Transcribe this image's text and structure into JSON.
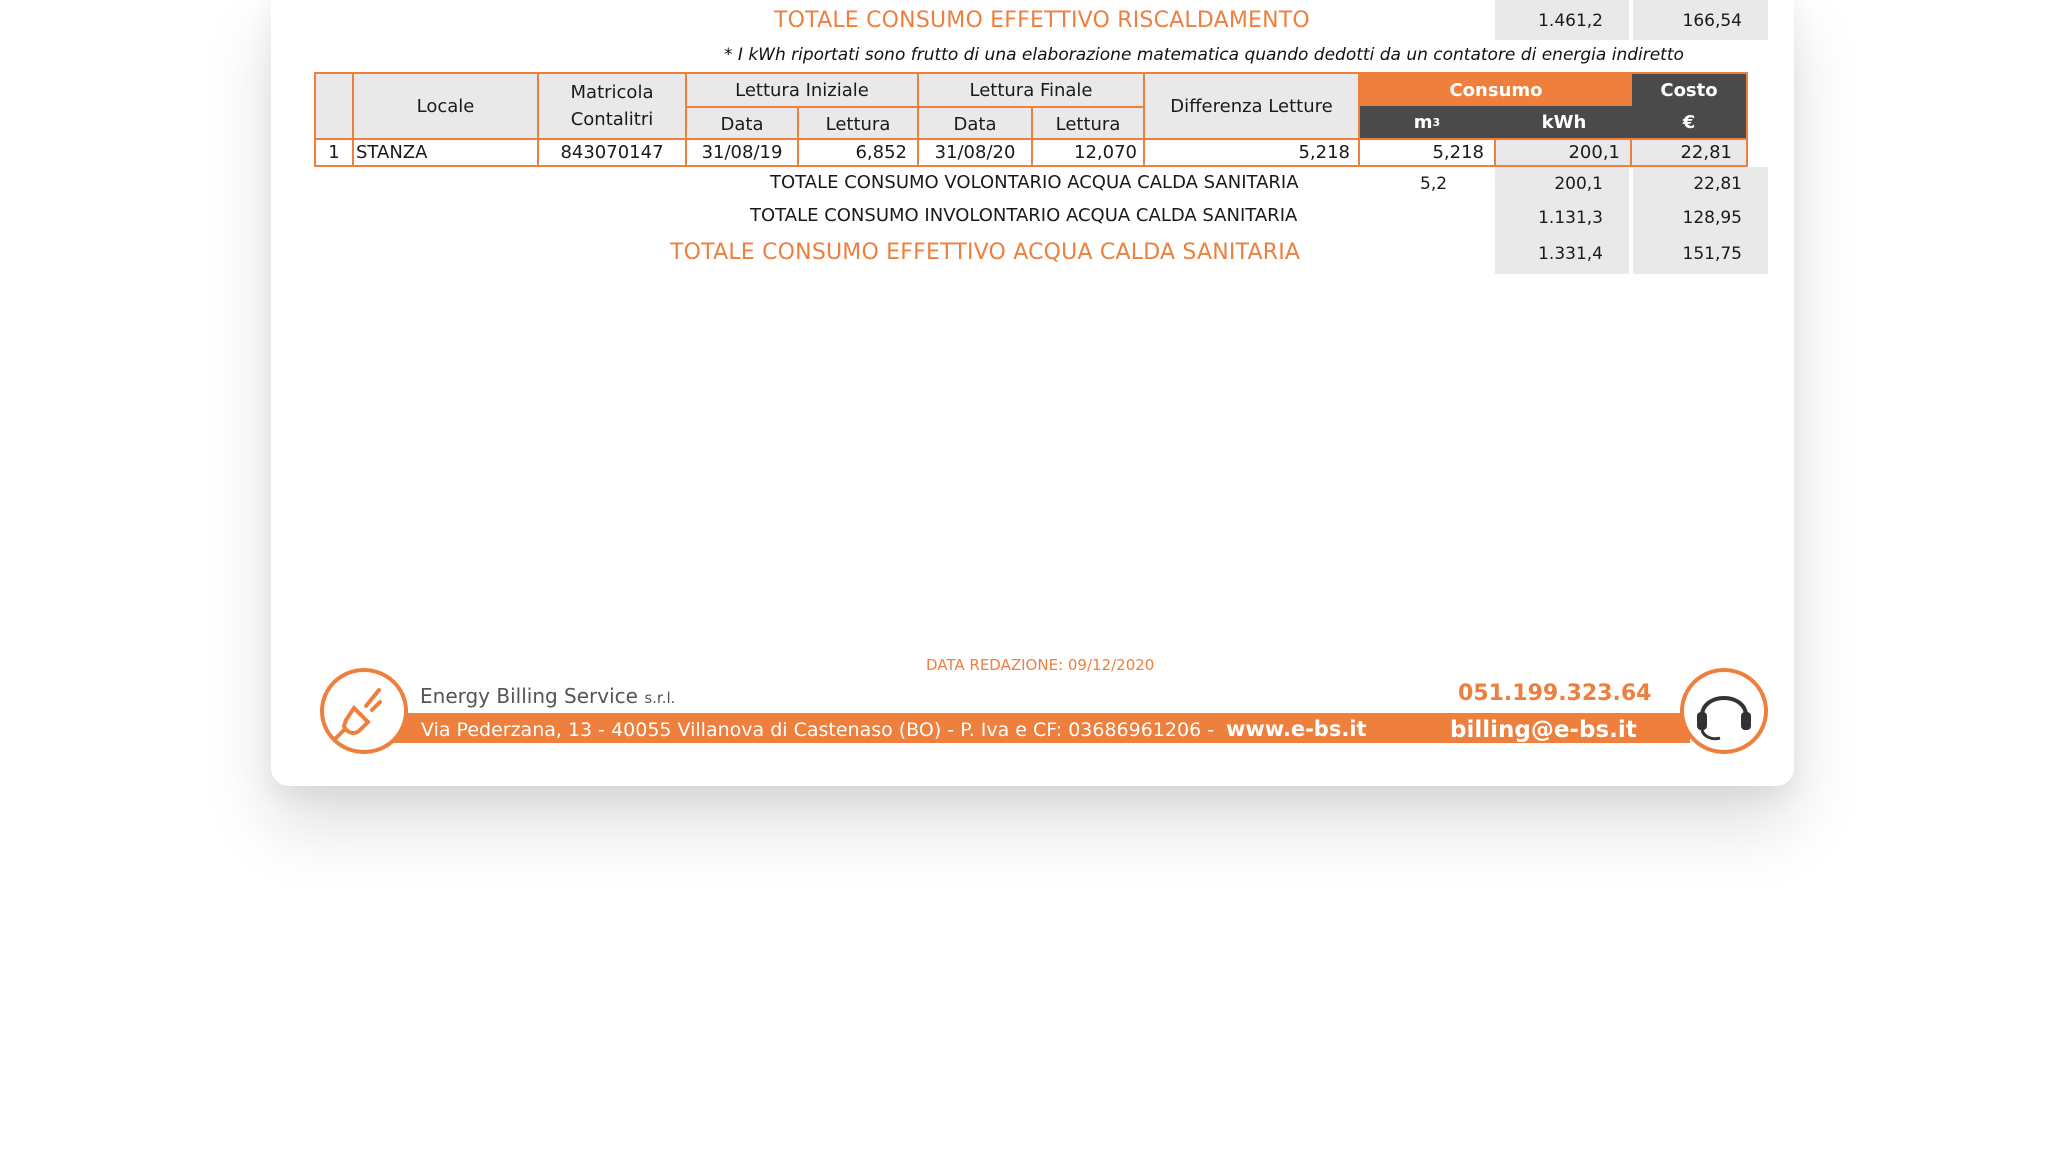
{
  "heating": {
    "total_label": "TOTALE CONSUMO EFFETTIVO RISCALDAMENTO",
    "kwh": "1.461,2",
    "cost": "166,54"
  },
  "note": "* I kWh riportati sono frutto di una elaborazione matematica quando dedotti da un contatore di energia indiretto",
  "table": {
    "headers": {
      "locale": "Locale",
      "matricola": "Matricola",
      "contalitri": "Contalitri",
      "lettura_iniziale": "Lettura Iniziale",
      "lettura_finale": "Lettura Finale",
      "data": "Data",
      "lettura": "Lettura",
      "differenza": "Differenza Letture",
      "consumo": "Consumo",
      "costo": "Costo",
      "m3": "m",
      "m3_sup": "3",
      "kwh": "kWh",
      "euro": "€"
    },
    "row": {
      "n": "1",
      "locale": "STANZA",
      "matricola": "843070147",
      "data_iniziale": "31/08/19",
      "lettura_iniziale": "6,852",
      "data_finale": "31/08/20",
      "lettura_finale": "12,070",
      "differenza": "5,218",
      "m3": "5,218",
      "kwh": "200,1",
      "costo": "22,81"
    }
  },
  "summary": {
    "volontario_label": "TOTALE CONSUMO VOLONTARIO ACQUA CALDA SANITARIA",
    "volontario_m3": "5,2",
    "volontario_kwh": "200,1",
    "volontario_cost": "22,81",
    "involontario_label": "TOTALE CONSUMO INVOLONTARIO ACQUA CALDA SANITARIA",
    "involontario_kwh": "1.131,3",
    "involontario_cost": "128,95",
    "effettivo_label": "TOTALE CONSUMO EFFETTIVO ACQUA CALDA SANITARIA",
    "effettivo_kwh": "1.331,4",
    "effettivo_cost": "151,75"
  },
  "footer": {
    "date_label": "DATA REDAZIONE: 09/12/2020",
    "company": "Energy Billing Service",
    "company_suffix": "s.r.l.",
    "phone": "051.199.323.64",
    "address": "Via Pederzana, 13 - 40055 Villanova di Castenaso (BO) - P. Iva e CF: 03686961206 -",
    "website": "www.e-bs.it",
    "email": "billing@e-bs.it",
    "logo_icon": "plug-icon",
    "support_icon": "headset-icon",
    "accent_color": "#ee7f3c"
  }
}
